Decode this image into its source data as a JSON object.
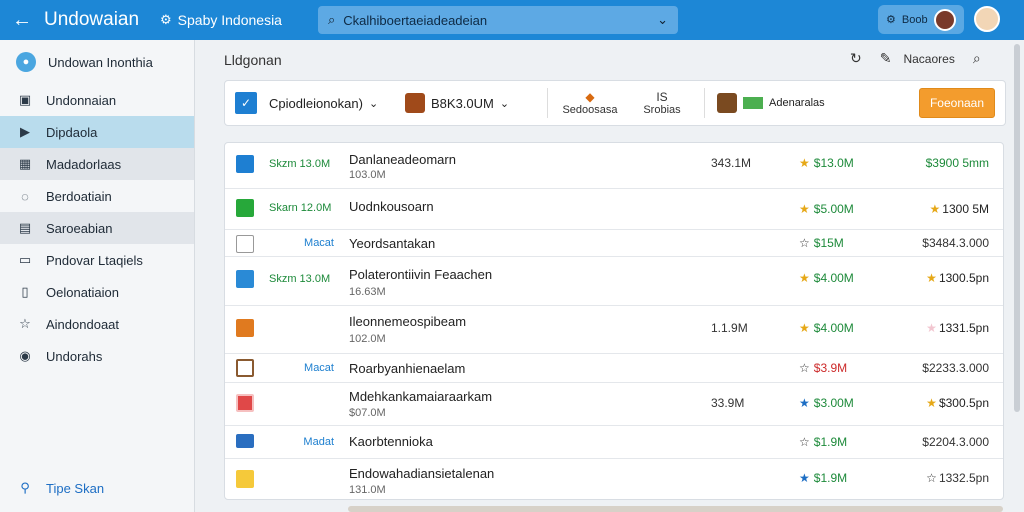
{
  "header": {
    "back": "←",
    "title": "Undowaian",
    "region": "Spaby Indonesia",
    "search_text": "Ckalhiboertaeiadeadeian",
    "user_label": "Boob"
  },
  "sidebar": {
    "items": [
      {
        "label": "Undowan Inonthia",
        "icon": "globe-icon"
      },
      {
        "label": "Undonnaian",
        "icon": "image-icon"
      },
      {
        "label": "Dipdaola",
        "icon": "video-icon"
      },
      {
        "label": "Madadorlaas",
        "icon": "grid-icon"
      },
      {
        "label": "Berdoatiain",
        "icon": "chat-icon"
      },
      {
        "label": "Saroeabian",
        "icon": "table-icon"
      },
      {
        "label": "Pndovar Ltaqiels",
        "icon": "monitor-icon"
      },
      {
        "label": "Oelonatiaion",
        "icon": "book-icon"
      },
      {
        "label": "Aindondoaat",
        "icon": "star-icon"
      },
      {
        "label": "Undorahs",
        "icon": "circle-icon"
      }
    ],
    "footer": "Tipe Skan"
  },
  "main": {
    "title": "Lldgonan",
    "tools_label": "Nacaores"
  },
  "toolbar": {
    "select1": "Cpiodleionokan)",
    "select2": "B8K3.0UM",
    "stat1_label": "Sedoosasa",
    "stat2_top": "IS",
    "stat2_label": "Srobias",
    "flag_label": "Adenaralas",
    "button": "Foeonaan"
  },
  "rows": [
    {
      "tag": "Skzm 13.0M",
      "title": "Danlaneadeomarn",
      "sub": "103.0M",
      "val": "343.1M",
      "rating": "$13.0M",
      "price": "$3900 5mm"
    },
    {
      "tag": "Skarn 12.0M",
      "title": "Uodnkousoarn",
      "sub": "",
      "val": "",
      "rating": "$5.00M",
      "price": "1300 5M"
    },
    {
      "tag": "Macat",
      "title": "Yeordsantakan",
      "sub": "",
      "val": "",
      "rating": "$15M",
      "price": "$3484.3.000"
    },
    {
      "tag": "Skzm 13.0M",
      "title": "Polaterontiivin Feaachen",
      "sub": "16.63M",
      "val": "",
      "rating": "$4.00M",
      "price": "1300.5pn"
    },
    {
      "tag": "",
      "title": "Ileonnemeospibeam",
      "sub": "102.0M",
      "val": "1.1.9M",
      "rating": "$4.00M",
      "price": "1331.5pn"
    },
    {
      "tag": "Macat",
      "title": "Roarbyanhienaelam",
      "sub": "",
      "val": "",
      "rating": "$3.9M",
      "price": "$2233.3.000"
    },
    {
      "tag": "",
      "title": "Mdehkankamaiaraarkam",
      "sub": "$07.0M",
      "val": "33.9M",
      "rating": "$3.00M",
      "price": "$300.5pn"
    },
    {
      "tag": "Madat",
      "title": "Kaorbtennioka",
      "sub": "",
      "val": "",
      "rating": "$1.9M",
      "price": "$2204.3.000"
    },
    {
      "tag": "",
      "title": "Endowahadiansietalenan",
      "sub": "131.0M",
      "val": "",
      "rating": "$1.9M",
      "price": "1332.5pn"
    }
  ]
}
